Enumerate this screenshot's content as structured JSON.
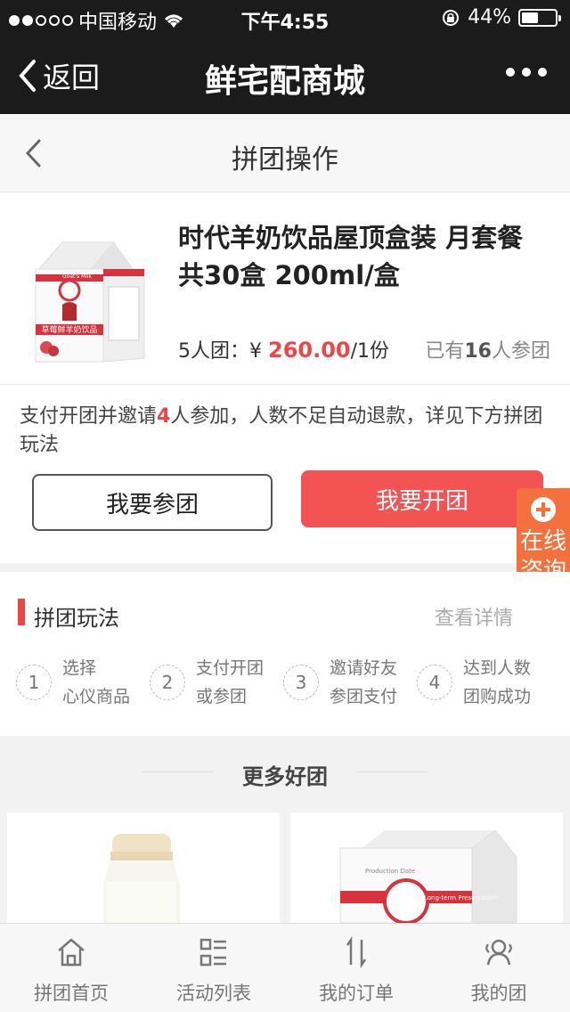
{
  "status": {
    "carrier": "中国移动",
    "time": "下午4:55",
    "battery": "44%"
  },
  "nav": {
    "back_label": "返回",
    "title": "鲜宅配商城"
  },
  "page": {
    "title": "拼团操作"
  },
  "product": {
    "name": "时代羊奶饮品屋顶盒装 月套餐 共30盒 200ml/盒",
    "group_size": "5人团：",
    "currency": "¥",
    "price": "260.00",
    "unit": "/1份",
    "joined_prefix": "已有",
    "joined_count": "16",
    "joined_suffix": "人参团",
    "package": {
      "front_text": "草莓鲜羊奶饮品",
      "brand": "Goat's Milk"
    }
  },
  "notice": {
    "part1": "支付开团并邀请",
    "count": "4",
    "part2": "人参加，人数不足自动退款，详见下方拼团玩法"
  },
  "buttons": {
    "join": "我要参团",
    "open": "我要开团"
  },
  "consult": {
    "label": "在线咨询"
  },
  "rules": {
    "title": "拼团玩法",
    "detail": "查看详情",
    "steps": [
      {
        "num": "1",
        "line1": "选择",
        "line2": "心仪商品"
      },
      {
        "num": "2",
        "line1": "支付开团",
        "line2": "或参团"
      },
      {
        "num": "3",
        "line1": "邀请好友",
        "line2": "参团支付"
      },
      {
        "num": "4",
        "line1": "达到人数",
        "line2": "团购成功"
      }
    ]
  },
  "more": {
    "title": "更多好团",
    "card2_caption": "Production Date",
    "card2_stripe": "Long-term Preservation"
  },
  "tabs": [
    {
      "label": "拼团首页",
      "icon": "home-icon"
    },
    {
      "label": "活动列表",
      "icon": "list-icon"
    },
    {
      "label": "我的订单",
      "icon": "sort-arrows-icon"
    },
    {
      "label": "我的团",
      "icon": "group-users-icon"
    }
  ],
  "colors": {
    "accent_red": "#f35353",
    "price_red": "#f04545",
    "consult_orange": "#f4713d",
    "header_dark": "#1b1b1b"
  }
}
